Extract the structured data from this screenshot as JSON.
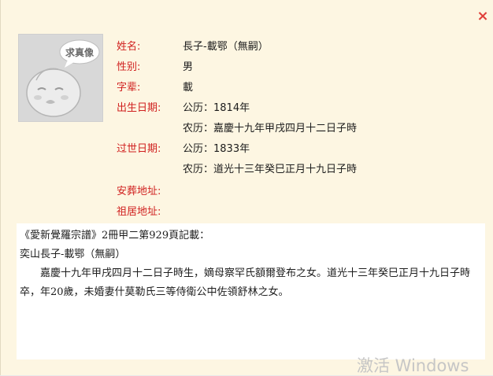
{
  "dialog": {
    "close_glyph": "×",
    "accent_color": "#d0201f",
    "background_color": "#fdf6e2"
  },
  "avatar": {
    "badge_text": "求真像",
    "icon": "placeholder-cartoon-face"
  },
  "person": {
    "name_label": "姓名:",
    "name_value": "長子-載鄂（無嗣）",
    "gender_label": "性别:",
    "gender_value": "男",
    "generation_label": "字辈:",
    "generation_value": "載",
    "birth_label": "出生日期:",
    "birth_gregorian": "公历：1814年",
    "birth_lunar": "农历：嘉慶十九年甲戌四月十二日子時",
    "death_label": "过世日期:",
    "death_gregorian": "公历：1833年",
    "death_lunar": "农历：道光十三年癸巳正月十九日子時",
    "burial_label": "安葬地址:",
    "burial_value": "",
    "residence_label": "祖居地址:",
    "residence_value": ""
  },
  "record": {
    "source_line": "《愛新覺羅宗譜》2冊甲二第929頁記載：",
    "title_line": "奕山長子-載鄂（無嗣）",
    "body": "嘉慶十九年甲戌四月十二日子時生，嫡母察罕氏額爾登布之女。道光十三年癸巳正月十九日子時卒，年20歲，未婚妻什莫勒氏三等侍衛公中佐領舒林之女。"
  },
  "watermark": {
    "text": "激活 Windows"
  }
}
